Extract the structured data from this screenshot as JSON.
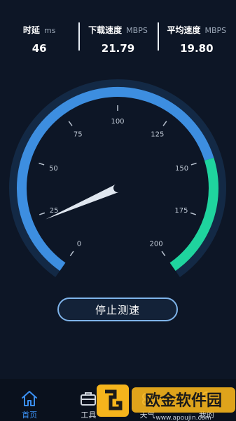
{
  "stats": [
    {
      "label": "时延",
      "unit": "ms",
      "value": "46"
    },
    {
      "label": "下载速度",
      "unit": "MBPS",
      "value": "21.79"
    },
    {
      "label": "平均速度",
      "unit": "MBPS",
      "value": "19.80"
    }
  ],
  "gauge": {
    "ticks": [
      "0",
      "25",
      "50",
      "75",
      "100",
      "125",
      "150",
      "175",
      "200"
    ],
    "max": 200,
    "needle_value": 21.79,
    "green_from": 150,
    "colors": {
      "blue": "#3d8ee0",
      "green": "#1fd49e",
      "track": "#1a3a5e"
    }
  },
  "button": {
    "label": "停止测速"
  },
  "tabs": [
    {
      "label": "首页",
      "icon": "home-icon",
      "active": true
    },
    {
      "label": "工具",
      "icon": "toolbox-icon",
      "active": false
    },
    {
      "label": "天气",
      "icon": "weather-icon",
      "active": false
    },
    {
      "label": "我的",
      "icon": "user-icon",
      "active": false
    }
  ],
  "watermark": {
    "title": "欧金软件园",
    "url": "www.apoujin.com"
  }
}
